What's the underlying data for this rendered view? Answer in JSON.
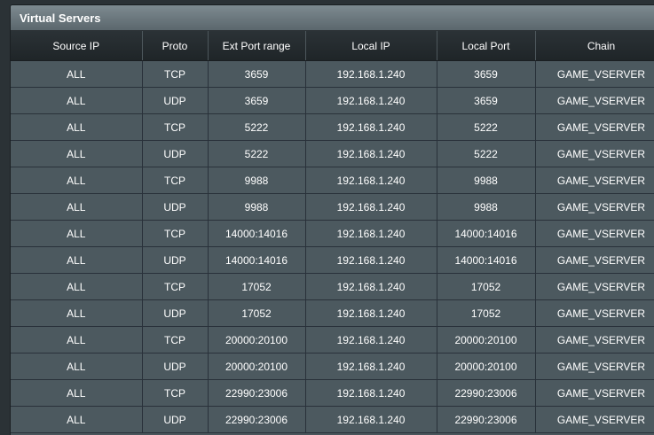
{
  "panel": {
    "title": "Virtual Servers"
  },
  "table": {
    "headers": [
      "Source IP",
      "Proto",
      "Ext Port range",
      "Local IP",
      "Local Port",
      "Chain"
    ],
    "rows": [
      [
        "ALL",
        "TCP",
        "3659",
        "192.168.1.240",
        "3659",
        "GAME_VSERVER"
      ],
      [
        "ALL",
        "UDP",
        "3659",
        "192.168.1.240",
        "3659",
        "GAME_VSERVER"
      ],
      [
        "ALL",
        "TCP",
        "5222",
        "192.168.1.240",
        "5222",
        "GAME_VSERVER"
      ],
      [
        "ALL",
        "UDP",
        "5222",
        "192.168.1.240",
        "5222",
        "GAME_VSERVER"
      ],
      [
        "ALL",
        "TCP",
        "9988",
        "192.168.1.240",
        "9988",
        "GAME_VSERVER"
      ],
      [
        "ALL",
        "UDP",
        "9988",
        "192.168.1.240",
        "9988",
        "GAME_VSERVER"
      ],
      [
        "ALL",
        "TCP",
        "14000:14016",
        "192.168.1.240",
        "14000:14016",
        "GAME_VSERVER"
      ],
      [
        "ALL",
        "UDP",
        "14000:14016",
        "192.168.1.240",
        "14000:14016",
        "GAME_VSERVER"
      ],
      [
        "ALL",
        "TCP",
        "17052",
        "192.168.1.240",
        "17052",
        "GAME_VSERVER"
      ],
      [
        "ALL",
        "UDP",
        "17052",
        "192.168.1.240",
        "17052",
        "GAME_VSERVER"
      ],
      [
        "ALL",
        "TCP",
        "20000:20100",
        "192.168.1.240",
        "20000:20100",
        "GAME_VSERVER"
      ],
      [
        "ALL",
        "UDP",
        "20000:20100",
        "192.168.1.240",
        "20000:20100",
        "GAME_VSERVER"
      ],
      [
        "ALL",
        "TCP",
        "22990:23006",
        "192.168.1.240",
        "22990:23006",
        "GAME_VSERVER"
      ],
      [
        "ALL",
        "UDP",
        "22990:23006",
        "192.168.1.240",
        "22990:23006",
        "GAME_VSERVER"
      ]
    ]
  }
}
